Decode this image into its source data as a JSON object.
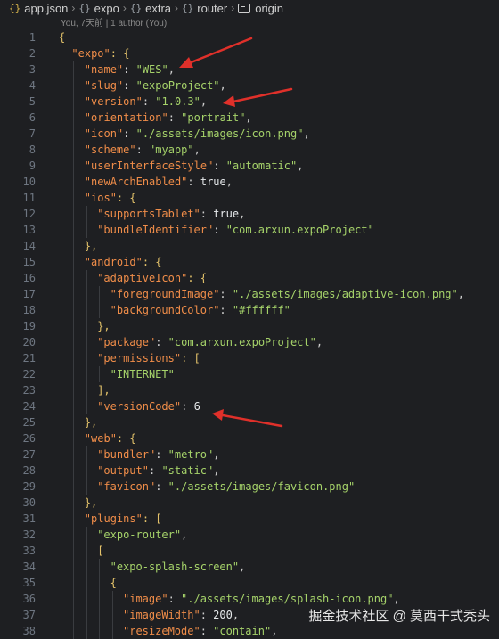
{
  "breadcrumb": {
    "file": "app.json",
    "segments": [
      "expo",
      "extra",
      "router"
    ],
    "branch": "origin"
  },
  "blame": "You, 7天前 | 1 author (You)",
  "watermark": "掘金技术社区 @ 莫西干式秃头",
  "colors": {
    "background": "#1e1f22",
    "key": "#f08d49",
    "string": "#a6d36a",
    "punct": "#e3c26a",
    "literal": "#e7eaec",
    "arrow": "#e0302a"
  },
  "lines": [
    {
      "n": "1",
      "indent": 0,
      "tokens": [
        {
          "t": "{",
          "c": "p"
        }
      ]
    },
    {
      "n": "2",
      "indent": 1,
      "tokens": [
        {
          "t": "\"expo\"",
          "c": "k"
        },
        {
          "t": ": {",
          "c": "p"
        }
      ]
    },
    {
      "n": "3",
      "indent": 2,
      "tokens": [
        {
          "t": "\"name\"",
          "c": "k"
        },
        {
          "t": ": ",
          "c": "b"
        },
        {
          "t": "\"WES\"",
          "c": "s"
        },
        {
          "t": ",",
          "c": "b"
        }
      ]
    },
    {
      "n": "4",
      "indent": 2,
      "tokens": [
        {
          "t": "\"slug\"",
          "c": "k"
        },
        {
          "t": ": ",
          "c": "b"
        },
        {
          "t": "\"expoProject\"",
          "c": "s"
        },
        {
          "t": ",",
          "c": "b"
        }
      ]
    },
    {
      "n": "5",
      "indent": 2,
      "tokens": [
        {
          "t": "\"version\"",
          "c": "k"
        },
        {
          "t": ": ",
          "c": "b"
        },
        {
          "t": "\"1.0.3\"",
          "c": "s"
        },
        {
          "t": ",",
          "c": "b"
        }
      ]
    },
    {
      "n": "6",
      "indent": 2,
      "tokens": [
        {
          "t": "\"orientation\"",
          "c": "k"
        },
        {
          "t": ": ",
          "c": "b"
        },
        {
          "t": "\"portrait\"",
          "c": "s"
        },
        {
          "t": ",",
          "c": "b"
        }
      ]
    },
    {
      "n": "7",
      "indent": 2,
      "tokens": [
        {
          "t": "\"icon\"",
          "c": "k"
        },
        {
          "t": ": ",
          "c": "b"
        },
        {
          "t": "\"./assets/images/icon.png\"",
          "c": "s"
        },
        {
          "t": ",",
          "c": "b"
        }
      ]
    },
    {
      "n": "8",
      "indent": 2,
      "tokens": [
        {
          "t": "\"scheme\"",
          "c": "k"
        },
        {
          "t": ": ",
          "c": "b"
        },
        {
          "t": "\"myapp\"",
          "c": "s"
        },
        {
          "t": ",",
          "c": "b"
        }
      ]
    },
    {
      "n": "9",
      "indent": 2,
      "tokens": [
        {
          "t": "\"userInterfaceStyle\"",
          "c": "k"
        },
        {
          "t": ": ",
          "c": "b"
        },
        {
          "t": "\"automatic\"",
          "c": "s"
        },
        {
          "t": ",",
          "c": "b"
        }
      ]
    },
    {
      "n": "10",
      "indent": 2,
      "tokens": [
        {
          "t": "\"newArchEnabled\"",
          "c": "k"
        },
        {
          "t": ": ",
          "c": "b"
        },
        {
          "t": "true",
          "c": "l"
        },
        {
          "t": ",",
          "c": "b"
        }
      ]
    },
    {
      "n": "11",
      "indent": 2,
      "tokens": [
        {
          "t": "\"ios\"",
          "c": "k"
        },
        {
          "t": ": {",
          "c": "p"
        }
      ]
    },
    {
      "n": "12",
      "indent": 3,
      "tokens": [
        {
          "t": "\"supportsTablet\"",
          "c": "k"
        },
        {
          "t": ": ",
          "c": "b"
        },
        {
          "t": "true",
          "c": "l"
        },
        {
          "t": ",",
          "c": "b"
        }
      ]
    },
    {
      "n": "13",
      "indent": 3,
      "tokens": [
        {
          "t": "\"bundleIdentifier\"",
          "c": "k"
        },
        {
          "t": ": ",
          "c": "b"
        },
        {
          "t": "\"com.arxun.expoProject\"",
          "c": "s"
        }
      ]
    },
    {
      "n": "14",
      "indent": 2,
      "tokens": [
        {
          "t": "},",
          "c": "p"
        }
      ]
    },
    {
      "n": "15",
      "indent": 2,
      "tokens": [
        {
          "t": "\"android\"",
          "c": "k"
        },
        {
          "t": ": {",
          "c": "p"
        }
      ]
    },
    {
      "n": "16",
      "indent": 3,
      "tokens": [
        {
          "t": "\"adaptiveIcon\"",
          "c": "k"
        },
        {
          "t": ": {",
          "c": "p"
        }
      ]
    },
    {
      "n": "17",
      "indent": 4,
      "tokens": [
        {
          "t": "\"foregroundImage\"",
          "c": "k"
        },
        {
          "t": ": ",
          "c": "b"
        },
        {
          "t": "\"./assets/images/adaptive-icon.png\"",
          "c": "s"
        },
        {
          "t": ",",
          "c": "b"
        }
      ]
    },
    {
      "n": "18",
      "indent": 4,
      "tokens": [
        {
          "t": "\"backgroundColor\"",
          "c": "k"
        },
        {
          "t": ": ",
          "c": "b"
        },
        {
          "t": "\"#ffffff\"",
          "c": "s"
        }
      ]
    },
    {
      "n": "19",
      "indent": 3,
      "tokens": [
        {
          "t": "},",
          "c": "p"
        }
      ]
    },
    {
      "n": "20",
      "indent": 3,
      "tokens": [
        {
          "t": "\"package\"",
          "c": "k"
        },
        {
          "t": ": ",
          "c": "b"
        },
        {
          "t": "\"com.arxun.expoProject\"",
          "c": "s"
        },
        {
          "t": ",",
          "c": "b"
        }
      ]
    },
    {
      "n": "21",
      "indent": 3,
      "tokens": [
        {
          "t": "\"permissions\"",
          "c": "k"
        },
        {
          "t": ": [",
          "c": "p"
        }
      ]
    },
    {
      "n": "22",
      "indent": 4,
      "tokens": [
        {
          "t": "\"INTERNET\"",
          "c": "s"
        }
      ]
    },
    {
      "n": "23",
      "indent": 3,
      "tokens": [
        {
          "t": "],",
          "c": "p"
        }
      ]
    },
    {
      "n": "24",
      "indent": 3,
      "tokens": [
        {
          "t": "\"versionCode\"",
          "c": "k"
        },
        {
          "t": ": ",
          "c": "b"
        },
        {
          "t": "6",
          "c": "n"
        }
      ]
    },
    {
      "n": "25",
      "indent": 2,
      "tokens": [
        {
          "t": "},",
          "c": "p"
        }
      ]
    },
    {
      "n": "26",
      "indent": 2,
      "tokens": [
        {
          "t": "\"web\"",
          "c": "k"
        },
        {
          "t": ": {",
          "c": "p"
        }
      ]
    },
    {
      "n": "27",
      "indent": 3,
      "tokens": [
        {
          "t": "\"bundler\"",
          "c": "k"
        },
        {
          "t": ": ",
          "c": "b"
        },
        {
          "t": "\"metro\"",
          "c": "s"
        },
        {
          "t": ",",
          "c": "b"
        }
      ]
    },
    {
      "n": "28",
      "indent": 3,
      "tokens": [
        {
          "t": "\"output\"",
          "c": "k"
        },
        {
          "t": ": ",
          "c": "b"
        },
        {
          "t": "\"static\"",
          "c": "s"
        },
        {
          "t": ",",
          "c": "b"
        }
      ]
    },
    {
      "n": "29",
      "indent": 3,
      "tokens": [
        {
          "t": "\"favicon\"",
          "c": "k"
        },
        {
          "t": ": ",
          "c": "b"
        },
        {
          "t": "\"./assets/images/favicon.png\"",
          "c": "s"
        }
      ]
    },
    {
      "n": "30",
      "indent": 2,
      "tokens": [
        {
          "t": "},",
          "c": "p"
        }
      ]
    },
    {
      "n": "31",
      "indent": 2,
      "tokens": [
        {
          "t": "\"plugins\"",
          "c": "k"
        },
        {
          "t": ": [",
          "c": "p"
        }
      ]
    },
    {
      "n": "32",
      "indent": 3,
      "tokens": [
        {
          "t": "\"expo-router\"",
          "c": "s"
        },
        {
          "t": ",",
          "c": "b"
        }
      ]
    },
    {
      "n": "33",
      "indent": 3,
      "tokens": [
        {
          "t": "[",
          "c": "p"
        }
      ]
    },
    {
      "n": "34",
      "indent": 4,
      "tokens": [
        {
          "t": "\"expo-splash-screen\"",
          "c": "s"
        },
        {
          "t": ",",
          "c": "b"
        }
      ]
    },
    {
      "n": "35",
      "indent": 4,
      "tokens": [
        {
          "t": "{",
          "c": "p"
        }
      ]
    },
    {
      "n": "36",
      "indent": 5,
      "tokens": [
        {
          "t": "\"image\"",
          "c": "k"
        },
        {
          "t": ": ",
          "c": "b"
        },
        {
          "t": "\"./assets/images/splash-icon.png\"",
          "c": "s"
        },
        {
          "t": ",",
          "c": "b"
        }
      ]
    },
    {
      "n": "37",
      "indent": 5,
      "tokens": [
        {
          "t": "\"imageWidth\"",
          "c": "k"
        },
        {
          "t": ": ",
          "c": "b"
        },
        {
          "t": "200",
          "c": "n"
        },
        {
          "t": ",",
          "c": "b"
        }
      ]
    },
    {
      "n": "38",
      "indent": 5,
      "tokens": [
        {
          "t": "\"resizeMode\"",
          "c": "k"
        },
        {
          "t": ": ",
          "c": "b"
        },
        {
          "t": "\"contain\"",
          "c": "s"
        },
        {
          "t": ",",
          "c": "b"
        }
      ]
    }
  ]
}
